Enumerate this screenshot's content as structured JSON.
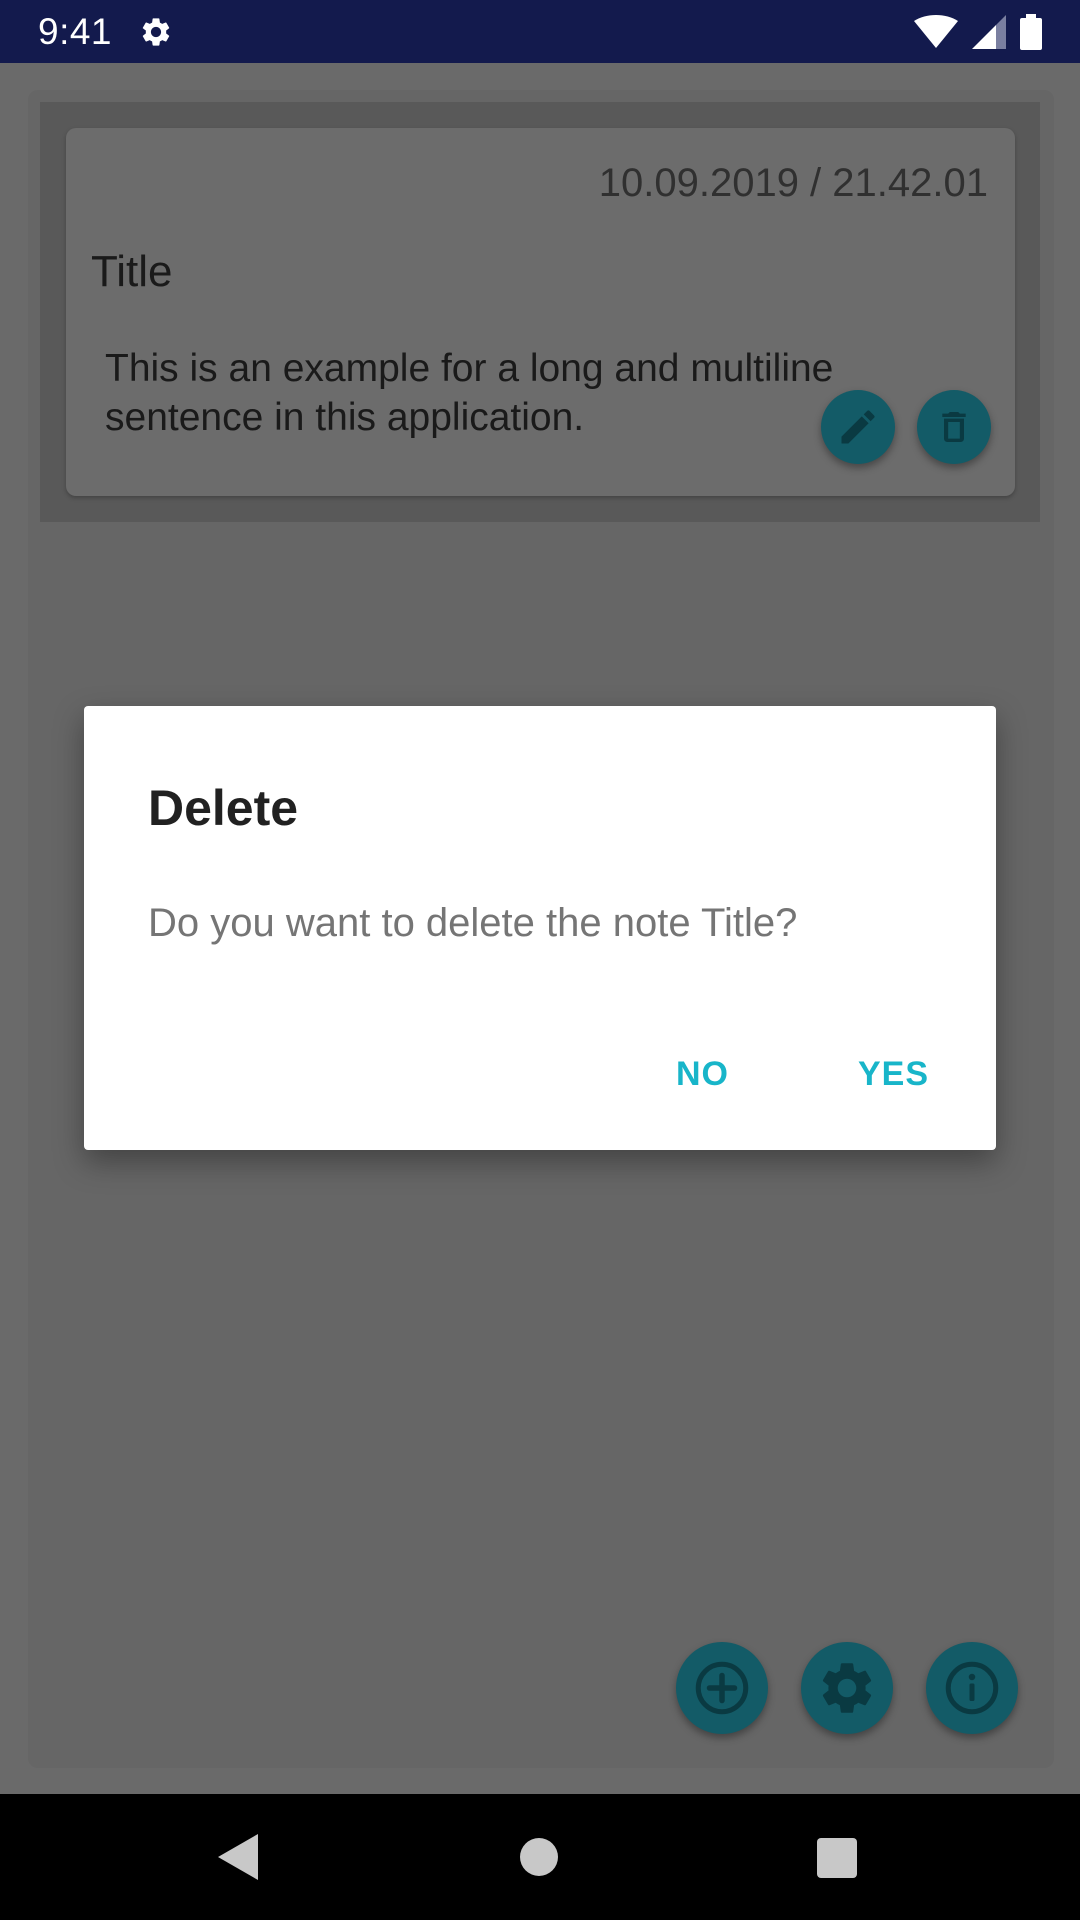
{
  "status_bar": {
    "time": "9:41",
    "icons": [
      "settings-icon",
      "wifi-icon",
      "cellular-signal-icon",
      "battery-icon"
    ]
  },
  "note": {
    "date": "10.09.2019 / 21.42.01",
    "title": "Title",
    "body": "This is an example for a long and multiline sentence in this application.",
    "actions": [
      "edit-icon",
      "trash-icon"
    ]
  },
  "fabs": [
    "add-icon",
    "settings-icon",
    "info-icon"
  ],
  "dialog": {
    "title": "Delete",
    "message": "Do you want to delete the note Title?",
    "no_label": "NO",
    "yes_label": "YES"
  },
  "navigation": [
    "back-icon",
    "home-icon",
    "recents-icon"
  ],
  "colors": {
    "status_bar": "#131a4d",
    "accent": "#18b5c9",
    "action_button": "#135b67",
    "scrim": "#6a6a6a",
    "dialog_background": "#ffffff"
  }
}
